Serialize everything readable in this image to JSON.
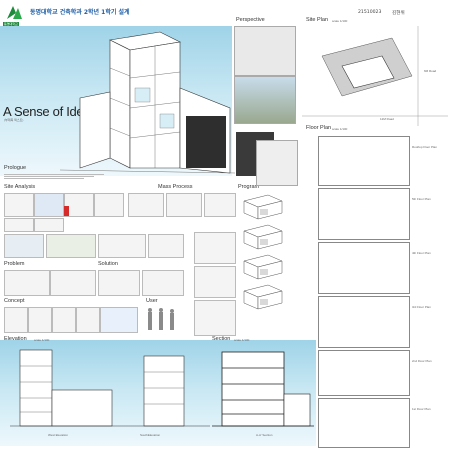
{
  "header": {
    "school_logo_text": "동명대학교",
    "title_korean": "동명대학교 건축학과 2학년 1학기 설계",
    "project_title": "A Sense of Identity",
    "subtitle_korean": "(부제목 텍스트)",
    "student_id": "21510023",
    "student_name": "김현위"
  },
  "sections": {
    "perspective": "Perspective",
    "site_plan": "Site Plan",
    "site_plan_scale": "scale 1/100",
    "floor_plan": "Floor Plan",
    "floor_plan_scale": "scale 1/100",
    "prologue": "Prologue",
    "site_analysis": "Site Analysis",
    "mass_process": "Mass Process",
    "program": "Program",
    "problem": "Problem",
    "solution": "Solution",
    "concept": "Concept",
    "user": "User",
    "elevation": "Elevation",
    "elevation_scale": "scale 1/100",
    "section": "Section",
    "section_scale": "scale 1/100"
  },
  "drawing_labels": {
    "west_elevation": "West Elevation",
    "south_elevation": "SouthElevation",
    "aa_section": "A-A' Section",
    "road_a": "12M Road",
    "road_b": "6M Road"
  },
  "floor_plan_labels": [
    "Rooftop Floor Plan",
    "5th Floor Plan",
    "4th Floor Plan",
    "3rd Floor Plan",
    "2nd Floor Plan",
    "1st Floor Plan"
  ]
}
